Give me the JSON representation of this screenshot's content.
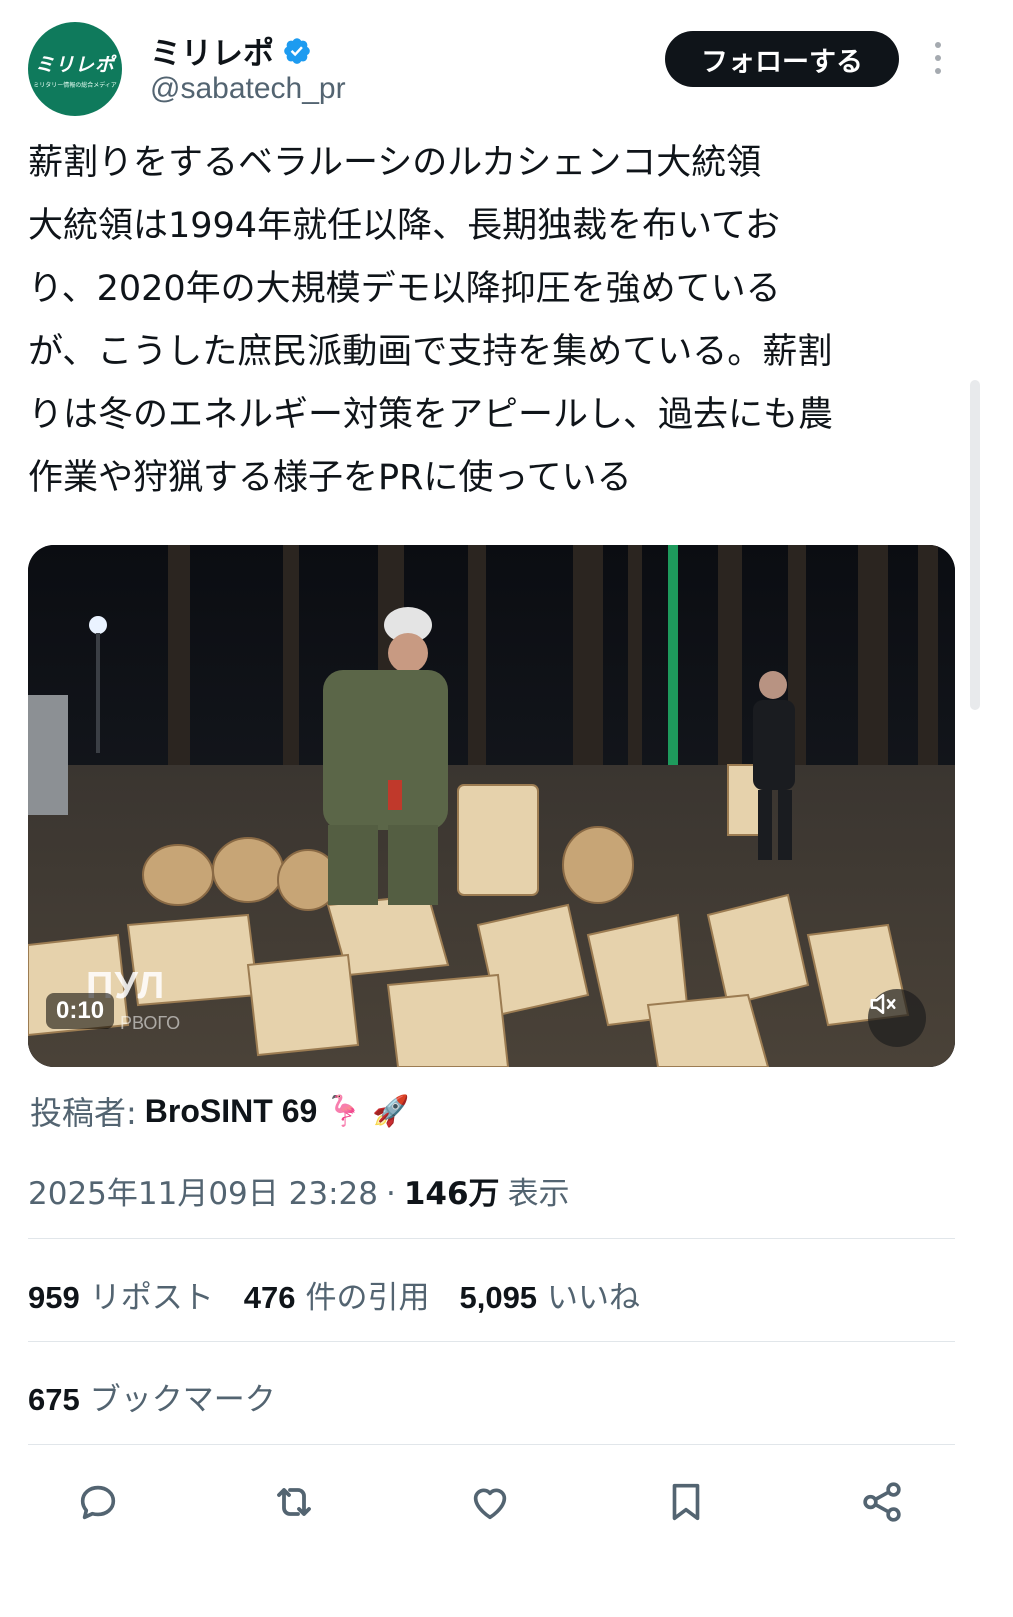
{
  "account": {
    "logo_text": "ミリレポ",
    "logo_subtext": "ミリタリー情報の総合メディア",
    "display_name": "ミリレポ",
    "handle": "@sabatech_pr",
    "follow_label": "フォローする"
  },
  "tweet": {
    "text": "薪割りをするベラルーシのルカシェンコ大統領\n大統領は1994年就任以降、長期独裁を布いてお\nり、2020年の大規模デモ以降抑圧を強めている\nが、こうした庶民派動画で支持を集めている。薪割\nりは冬のエネルギー対策をアピールし、過去にも農\n作業や狩猟する様子をPRに使っている"
  },
  "media": {
    "duration": "0:10",
    "watermark": "ПУЛ",
    "watermark_sub": "РВОГО",
    "mute_icon": "muted-speaker-icon"
  },
  "attribution": {
    "label": "投稿者:",
    "poster": "BroSINT 69",
    "emojis": "🦩 🚀"
  },
  "meta": {
    "timestamp": "2025年11月09日 23:28",
    "separator": "·",
    "views_count": "146万",
    "views_label": "表示"
  },
  "stats": {
    "reposts": {
      "num": "959",
      "label": "リポスト"
    },
    "quotes": {
      "num": "476",
      "label": "件の引用"
    },
    "likes": {
      "num": "5,095",
      "label": "いいね"
    },
    "bookmarks": {
      "num": "675",
      "label": "ブックマーク"
    }
  },
  "colors": {
    "brand_green": "#0f7a5c",
    "verified_blue": "#1d9bf0",
    "text_primary": "#0f1419",
    "text_secondary": "#536471"
  },
  "icons": [
    "verified-badge-icon",
    "more-icon",
    "reply-icon",
    "repost-icon",
    "like-icon",
    "bookmark-icon",
    "share-icon"
  ]
}
